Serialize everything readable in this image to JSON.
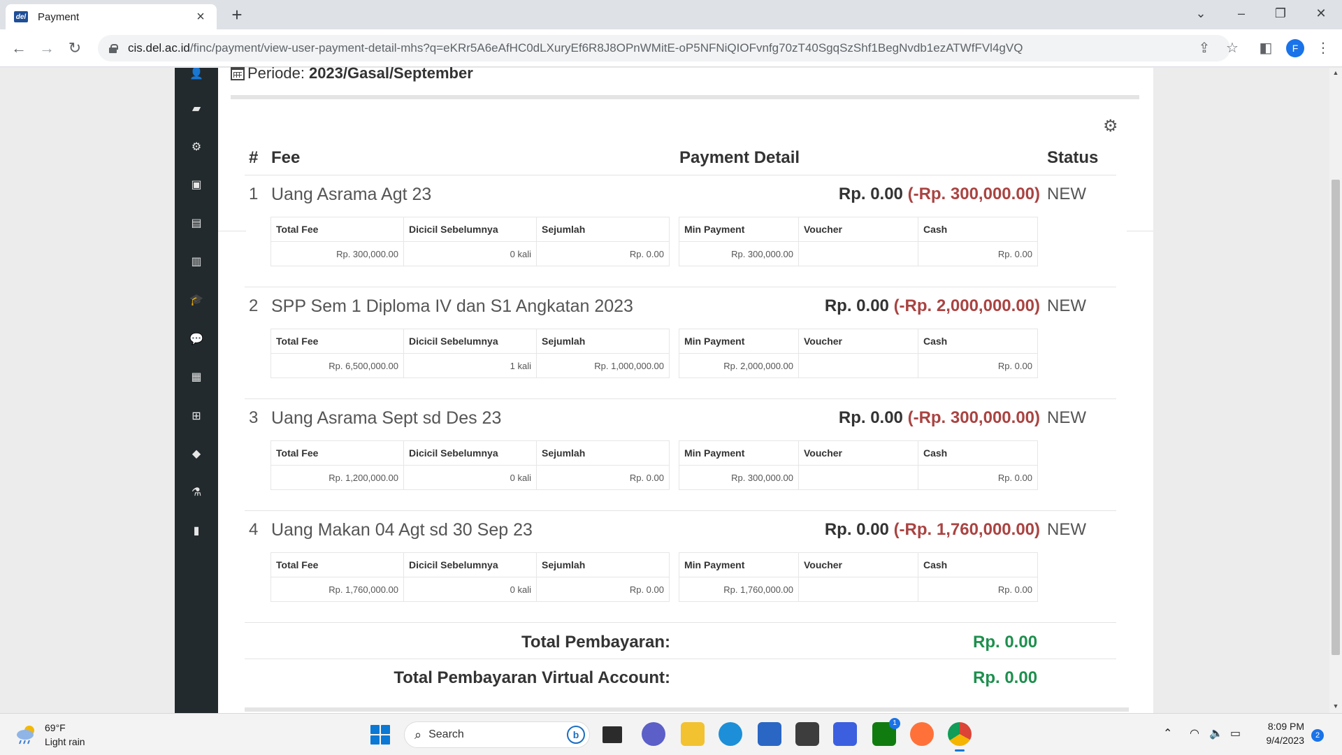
{
  "browser": {
    "tab_title": "Payment",
    "tab_favicon": "del",
    "url_host": "cis.del.ac.id",
    "url_path": "/finc/payment/view-user-payment-detail-mhs?q=eKRr5A6eAfHC0dLXuryEf6R8J8OPnWMitE-oP5NFNiQIOFvnfg70zT40SgqSzShf1BegNvdb1ezATWfFVl4gVQ",
    "profile_initial": "F"
  },
  "periode": {
    "label": "Periode:",
    "value": "2023/Gasal/September"
  },
  "table_headers": {
    "num": "#",
    "fee": "Fee",
    "payment_detail": "Payment Detail",
    "status": "Status"
  },
  "sub_headers": [
    "Total Fee",
    "Dicicil Sebelumnya",
    "Sejumlah",
    "Min Payment",
    "Voucher",
    "Cash"
  ],
  "fees": [
    {
      "num": "1",
      "name": "Uang Asrama Agt 23",
      "paid": "Rp. 0.00",
      "remaining": "(-Rp. 300,000.00)",
      "status": "NEW",
      "total_fee": "Rp. 300,000.00",
      "dicicil": "0 kali",
      "sejumlah": "Rp. 0.00",
      "min_payment": "Rp. 300,000.00",
      "voucher": "",
      "cash": "Rp. 0.00"
    },
    {
      "num": "2",
      "name": "SPP Sem 1 Diploma IV dan S1 Angkatan 2023",
      "paid": "Rp. 0.00",
      "remaining": "(-Rp. 2,000,000.00)",
      "status": "NEW",
      "total_fee": "Rp. 6,500,000.00",
      "dicicil": "1 kali",
      "sejumlah": "Rp. 1,000,000.00",
      "min_payment": "Rp. 2,000,000.00",
      "voucher": "",
      "cash": "Rp. 0.00"
    },
    {
      "num": "3",
      "name": "Uang Asrama Sept sd Des 23",
      "paid": "Rp. 0.00",
      "remaining": "(-Rp. 300,000.00)",
      "status": "NEW",
      "total_fee": "Rp. 1,200,000.00",
      "dicicil": "0 kali",
      "sejumlah": "Rp. 0.00",
      "min_payment": "Rp. 300,000.00",
      "voucher": "",
      "cash": "Rp. 0.00"
    },
    {
      "num": "4",
      "name": "Uang Makan 04 Agt sd 30 Sep 23",
      "paid": "Rp. 0.00",
      "remaining": "(-Rp. 1,760,000.00)",
      "status": "NEW",
      "total_fee": "Rp. 1,760,000.00",
      "dicicil": "0 kali",
      "sejumlah": "Rp. 0.00",
      "min_payment": "Rp. 1,760,000.00",
      "voucher": "",
      "cash": "Rp. 0.00"
    }
  ],
  "totals": {
    "total_label": "Total Pembayaran:",
    "total_value": "Rp. 0.00",
    "va_label": "Total Pembayaran Virtual Account:",
    "va_value": "Rp. 0.00"
  },
  "sidebar_icons": [
    "user-icon",
    "book-icon",
    "cogs-icon",
    "money-icon",
    "file-icon",
    "id-card-icon",
    "graduation-cap-icon",
    "comments-icon",
    "archive-icon",
    "plus-square-icon",
    "ticket-icon",
    "flask-icon",
    "bar-chart-icon"
  ],
  "colors": {
    "negative": "#a94442",
    "positive": "#1e8f4e",
    "sidebar": "#222a2d"
  },
  "taskbar": {
    "temperature": "69°F",
    "weather": "Light rain",
    "search_label": "Search",
    "time": "8:09 PM",
    "date": "9/4/2023",
    "notification_count": "2",
    "xbox_badge": "1"
  }
}
